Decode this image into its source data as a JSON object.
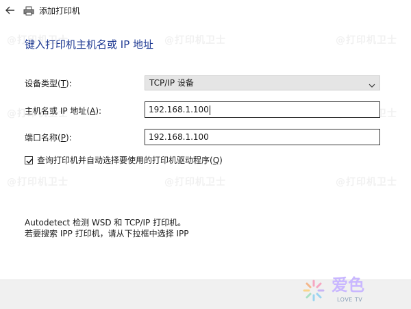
{
  "window": {
    "title": "添加打印机"
  },
  "page": {
    "heading": "键入打印机主机名或 IP 地址"
  },
  "form": {
    "device_type": {
      "label_prefix": "设备类型(",
      "label_key": "T",
      "label_suffix": "):",
      "selected": "TCP/IP 设备"
    },
    "host": {
      "label_prefix": "主机名或 IP 地址(",
      "label_key": "A",
      "label_suffix": "):",
      "value": "192.168.1.100"
    },
    "port": {
      "label_prefix": "端口名称(",
      "label_key": "P",
      "label_suffix": "):",
      "value": "192.168.1.100"
    },
    "auto_driver": {
      "checked": true,
      "label_prefix": "查询打印机并自动选择要使用的打印机驱动程序(",
      "label_key": "Q",
      "label_suffix": ")"
    }
  },
  "info": {
    "line1": "Autodetect 检测 WSD 和 TCP/IP 打印机。",
    "line2": "若要搜索 IPP 打印机，请从下拉框中选择 IPP"
  },
  "watermark": {
    "text": "@打印机卫士"
  },
  "logo": {
    "main": "爱色",
    "sub": "LOVE TV"
  },
  "colors": {
    "heading": "#1f3a93",
    "dropdown_bg": "#e5e5e5",
    "footer_bg": "#f0f0f0"
  }
}
